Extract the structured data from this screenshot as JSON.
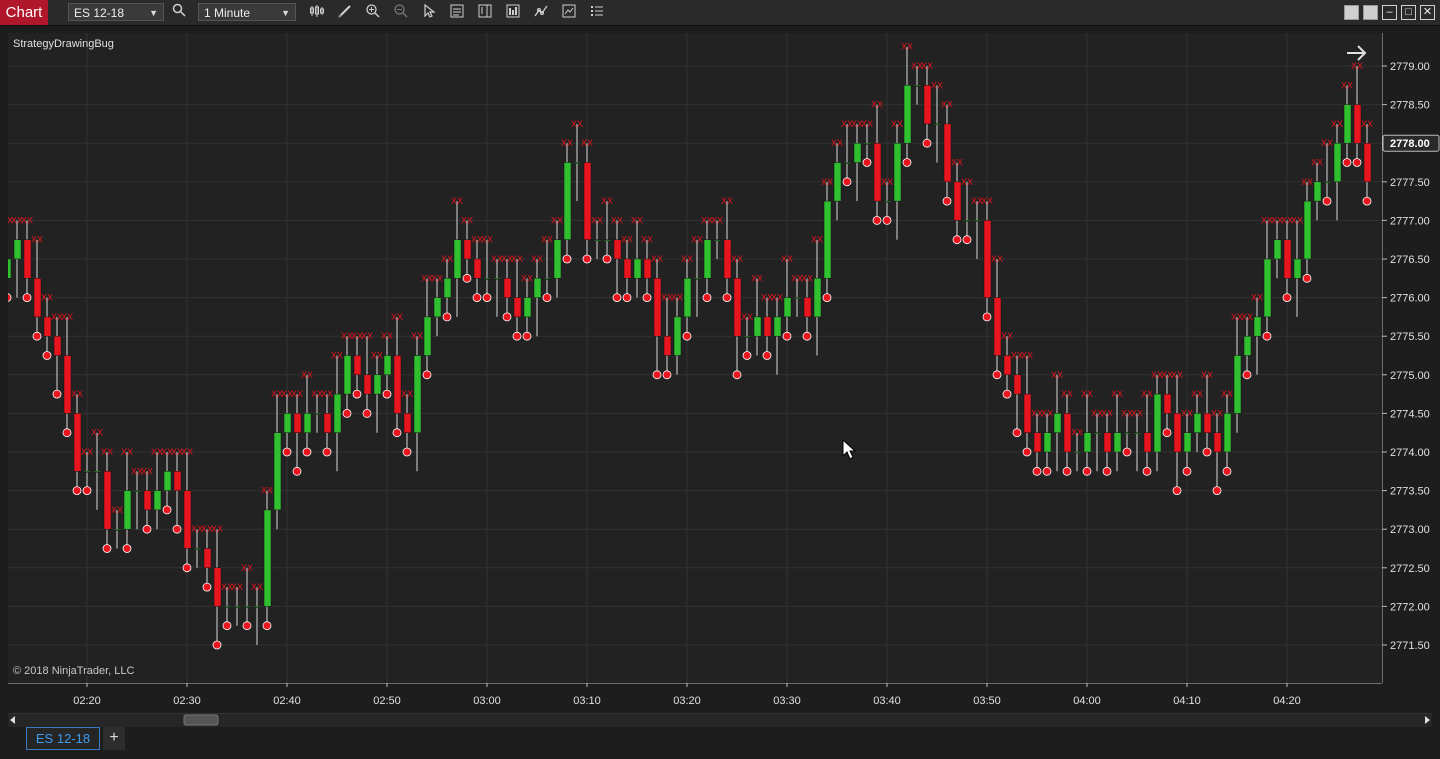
{
  "toolbar": {
    "chart_tab_label": "Chart",
    "instrument": "ES 12-18",
    "interval": "1 Minute",
    "icons": [
      "bars-type-icon",
      "drawing-tool-icon",
      "zoom-in-icon",
      "zoom-out-icon",
      "pointer-icon",
      "data-box-icon",
      "chart-trader-icon",
      "indicators-icon",
      "strategies-icon",
      "templates-icon",
      "properties-icon"
    ]
  },
  "window_controls": [
    "tile-icon",
    "tile-icon",
    "minimize-icon",
    "maximize-icon",
    "close-icon"
  ],
  "chart": {
    "strategy_label": "StrategyDrawingBug",
    "copyright": "© 2018 NinjaTrader, LLC",
    "last_price_label": "2778.00",
    "colors": {
      "up": "#2fbf2f",
      "down": "#e8141e",
      "marker": "#e8141e",
      "background": "#222222",
      "grid": "#333333"
    }
  },
  "chart_data": {
    "type": "candlestick",
    "instrument": "ES 12-18",
    "x_ticks": [
      "02:20",
      "02:30",
      "02:40",
      "02:50",
      "03:00",
      "03:10",
      "03:20",
      "03:30",
      "03:40",
      "03:50",
      "04:00",
      "04:10",
      "04:20"
    ],
    "y_ticks": [
      "2779.00",
      "2778.50",
      "2778.00",
      "2777.50",
      "2777.00",
      "2776.50",
      "2776.00",
      "2775.50",
      "2775.00",
      "2774.50",
      "2774.00",
      "2773.50",
      "2773.00",
      "2772.50",
      "2772.00",
      "2771.50"
    ],
    "ylim": [
      2771.25,
      2779.25
    ],
    "current_price": 2778.0,
    "close_path": [
      2776.25,
      2776.5,
      2775.75,
      2774.75,
      2773.25,
      2773.75,
      2773.0,
      2773.5,
      2773.25,
      2773.75,
      2772.75,
      2772.0,
      2771.75,
      2772.25,
      2773.5,
      2774.5,
      2774.25,
      2774.75,
      2775.0,
      2774.75,
      2775.25,
      2774.5,
      2775.0,
      2776.25,
      2776.75,
      2776.5,
      2775.75,
      2776.0,
      2776.25,
      2776.75,
      2777.5,
      2777.0,
      2776.5,
      2776.25,
      2776.0,
      2775.5,
      2776.0,
      2776.75,
      2776.25,
      2775.75,
      2775.5,
      2775.75,
      2776.0,
      2776.5,
      2777.5,
      2778.0,
      2777.5,
      2777.75,
      2778.75,
      2778.25,
      2777.5,
      2777.0,
      2775.75,
      2775.0,
      2774.5,
      2774.0,
      2774.25,
      2774.0,
      2774.5,
      2773.75,
      2774.25,
      2774.75,
      2774.25,
      2774.0,
      2774.25,
      2775.0,
      2775.75,
      2776.25,
      2776.75,
      2777.25,
      2777.75,
      2778.25,
      2778.0
    ],
    "markers": [
      "up-candle",
      "down-candle",
      "swing-dot",
      "xxx-label"
    ]
  },
  "bottom": {
    "tab_label": "ES 12-18",
    "add_tab": "+"
  }
}
